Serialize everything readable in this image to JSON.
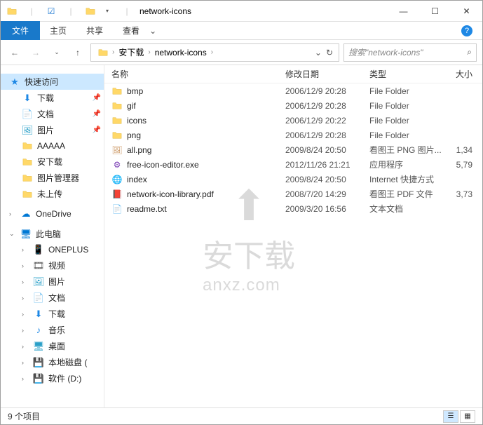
{
  "window": {
    "title": "network-icons",
    "controls": {
      "min": "—",
      "max": "☐",
      "close": "✕"
    }
  },
  "ribbon": {
    "file": "文件",
    "tabs": [
      "主页",
      "共享",
      "查看"
    ],
    "help": "?"
  },
  "nav": {
    "breadcrumb": [
      "安下载",
      "network-icons"
    ],
    "search_placeholder": "搜索\"network-icons\""
  },
  "sidebar": {
    "quick_access": "快速访问",
    "quick_items": [
      {
        "icon": "download",
        "label": "下载",
        "pinned": true
      },
      {
        "icon": "doc",
        "label": "文档",
        "pinned": true
      },
      {
        "icon": "pic",
        "label": "图片",
        "pinned": true
      },
      {
        "icon": "folder",
        "label": "AAAAA",
        "pinned": false
      },
      {
        "icon": "folder",
        "label": "安下载",
        "pinned": false
      },
      {
        "icon": "folder",
        "label": "图片管理器",
        "pinned": false
      },
      {
        "icon": "folder",
        "label": "未上传",
        "pinned": false
      }
    ],
    "onedrive": "OneDrive",
    "this_pc": "此电脑",
    "pc_items": [
      {
        "icon": "phone",
        "label": "ONEPLUS"
      },
      {
        "icon": "video",
        "label": "视频"
      },
      {
        "icon": "pic",
        "label": "图片"
      },
      {
        "icon": "doc",
        "label": "文档"
      },
      {
        "icon": "download",
        "label": "下载"
      },
      {
        "icon": "music",
        "label": "音乐"
      },
      {
        "icon": "desktop",
        "label": "桌面"
      },
      {
        "icon": "disk",
        "label": "本地磁盘 ("
      },
      {
        "icon": "disk",
        "label": "软件 (D:)"
      }
    ]
  },
  "columns": {
    "name": "名称",
    "date": "修改日期",
    "type": "类型",
    "size": "大小"
  },
  "files": [
    {
      "icon": "folder",
      "name": "bmp",
      "date": "2006/12/9 20:28",
      "type": "File Folder",
      "size": ""
    },
    {
      "icon": "folder",
      "name": "gif",
      "date": "2006/12/9 20:28",
      "type": "File Folder",
      "size": ""
    },
    {
      "icon": "folder",
      "name": "icons",
      "date": "2006/12/9 20:22",
      "type": "File Folder",
      "size": ""
    },
    {
      "icon": "folder",
      "name": "png",
      "date": "2006/12/9 20:28",
      "type": "File Folder",
      "size": ""
    },
    {
      "icon": "png",
      "name": "all.png",
      "date": "2009/8/24 20:50",
      "type": "看图王 PNG 图片...",
      "size": "1,34"
    },
    {
      "icon": "exe",
      "name": "free-icon-editor.exe",
      "date": "2012/11/26 21:21",
      "type": "应用程序",
      "size": "5,79"
    },
    {
      "icon": "url",
      "name": "index",
      "date": "2009/8/24 20:50",
      "type": "Internet 快捷方式",
      "size": ""
    },
    {
      "icon": "pdf",
      "name": "network-icon-library.pdf",
      "date": "2008/7/20 14:29",
      "type": "看图王 PDF 文件",
      "size": "3,73"
    },
    {
      "icon": "txt",
      "name": "readme.txt",
      "date": "2009/3/20 16:56",
      "type": "文本文档",
      "size": ""
    }
  ],
  "status": {
    "items": "9 个项目"
  },
  "watermark": {
    "main": "安下载",
    "sub": "anxz.com"
  }
}
